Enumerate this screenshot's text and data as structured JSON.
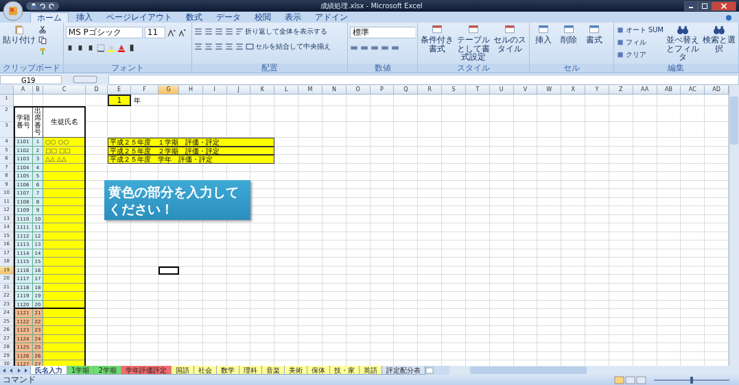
{
  "window": {
    "title": "成績処理.xlsx - Microsoft Excel"
  },
  "ribbon": {
    "tabs": [
      {
        "label": "ホーム",
        "selected": true
      },
      {
        "label": "挿入",
        "selected": false
      },
      {
        "label": "ページレイアウト",
        "selected": false
      },
      {
        "label": "数式",
        "selected": false
      },
      {
        "label": "データ",
        "selected": false
      },
      {
        "label": "校閲",
        "selected": false
      },
      {
        "label": "表示",
        "selected": false
      },
      {
        "label": "アドイン",
        "selected": false
      }
    ],
    "groups": [
      {
        "kind": "clipboard",
        "label": "クリップボード",
        "paste": "貼り付け"
      },
      {
        "kind": "font",
        "label": "フォント",
        "font": "MS Pゴシック",
        "size": "11"
      },
      {
        "kind": "alignment",
        "label": "配置",
        "wrap": "折り返して全体を表示する",
        "merge": "セルを結合して中央揃え"
      },
      {
        "kind": "number",
        "label": "数値",
        "format": "標準"
      },
      {
        "kind": "styles",
        "label": "スタイル",
        "buttons": [
          "条件付き書式",
          "テーブルとして書式設定",
          "セルのスタイル"
        ]
      },
      {
        "kind": "cells",
        "label": "セル",
        "buttons": [
          "挿入",
          "削除",
          "書式"
        ]
      },
      {
        "kind": "editing",
        "label": "編集",
        "small": [
          "オート SUM",
          "フィル",
          "クリア"
        ],
        "buttons": [
          "並べ替えとフィルタ",
          "検索と選択"
        ]
      }
    ]
  },
  "formula_bar": {
    "name_box": "G19"
  },
  "sheet": {
    "columns": [
      {
        "label": "A",
        "selected": false
      },
      {
        "label": "B",
        "selected": false
      },
      {
        "label": "C",
        "selected": false
      },
      {
        "label": "D",
        "selected": false
      },
      {
        "label": "E",
        "selected": false
      },
      {
        "label": "F",
        "selected": false
      },
      {
        "label": "G",
        "selected": true
      },
      {
        "label": "H",
        "selected": false
      },
      {
        "label": "I",
        "selected": false
      },
      {
        "label": "J",
        "selected": false
      },
      {
        "label": "K",
        "selected": false
      },
      {
        "label": "L",
        "selected": false
      },
      {
        "label": "M",
        "selected": false
      },
      {
        "label": "N",
        "selected": false
      },
      {
        "label": "O",
        "selected": false
      },
      {
        "label": "P",
        "selected": false
      },
      {
        "label": "Q",
        "selected": false
      },
      {
        "label": "R",
        "selected": false
      },
      {
        "label": "S",
        "selected": false
      },
      {
        "label": "T",
        "selected": false
      },
      {
        "label": "U",
        "selected": false
      },
      {
        "label": "V",
        "selected": false
      },
      {
        "label": "W",
        "selected": false
      },
      {
        "label": "X",
        "selected": false
      },
      {
        "label": "Y",
        "selected": false
      },
      {
        "label": "Z",
        "selected": false
      },
      {
        "label": "AA",
        "selected": false
      },
      {
        "label": "AB",
        "selected": false
      },
      {
        "label": "AC",
        "selected": false
      },
      {
        "label": "AD",
        "selected": false
      }
    ],
    "rows": [
      {
        "label": "1",
        "selected": false
      },
      {
        "label": "2",
        "selected": false
      },
      {
        "label": "3",
        "selected": false
      },
      {
        "label": "4",
        "selected": false
      },
      {
        "label": "5",
        "selected": false
      },
      {
        "label": "6",
        "selected": false
      },
      {
        "label": "7",
        "selected": false
      },
      {
        "label": "8",
        "selected": false
      },
      {
        "label": "9",
        "selected": false
      },
      {
        "label": "10",
        "selected": false
      },
      {
        "label": "11",
        "selected": false
      },
      {
        "label": "12",
        "selected": false
      },
      {
        "label": "13",
        "selected": false
      },
      {
        "label": "14",
        "selected": false
      },
      {
        "label": "15",
        "selected": false
      },
      {
        "label": "16",
        "selected": false
      },
      {
        "label": "17",
        "selected": false
      },
      {
        "label": "18",
        "selected": false
      },
      {
        "label": "19",
        "selected": true
      },
      {
        "label": "20",
        "selected": false
      },
      {
        "label": "21",
        "selected": false
      },
      {
        "label": "22",
        "selected": false
      },
      {
        "label": "23",
        "selected": false
      },
      {
        "label": "24",
        "selected": false
      },
      {
        "label": "25",
        "selected": false
      },
      {
        "label": "26",
        "selected": false
      },
      {
        "label": "27",
        "selected": false
      },
      {
        "label": "28",
        "selected": false
      },
      {
        "label": "29",
        "selected": false
      },
      {
        "label": "30",
        "selected": false
      }
    ],
    "year": {
      "value": "1",
      "unit": "年"
    },
    "headers": [
      "学籍番号",
      "出席番号",
      "生徒氏名"
    ],
    "students": [
      {
        "id": "1101",
        "no": "1",
        "name": "○○ ○○",
        "color": "#d6eef6"
      },
      {
        "id": "1102",
        "no": "2",
        "name": "□□ □□",
        "color": "#d6eef6"
      },
      {
        "id": "1103",
        "no": "3",
        "name": "△△ △△",
        "color": "#d6eef6"
      },
      {
        "id": "1104",
        "no": "4",
        "color": "#d6eef6"
      },
      {
        "id": "1105",
        "no": "5",
        "color": "#d6eef6"
      },
      {
        "id": "1106",
        "no": "6",
        "color": "#d6eef6"
      },
      {
        "id": "1107",
        "no": "7",
        "color": "#d6eef6"
      },
      {
        "id": "1108",
        "no": "8",
        "color": "#d6eef6"
      },
      {
        "id": "1109",
        "no": "9",
        "color": "#d6eef6"
      },
      {
        "id": "1110",
        "no": "10",
        "color": "#d6eef6"
      },
      {
        "id": "1111",
        "no": "11",
        "color": "#d6eef6"
      },
      {
        "id": "1112",
        "no": "12",
        "color": "#d6eef6"
      },
      {
        "id": "1113",
        "no": "13",
        "color": "#d6eef6"
      },
      {
        "id": "1114",
        "no": "14",
        "color": "#d6eef6"
      },
      {
        "id": "1115",
        "no": "15",
        "color": "#d6eef6"
      },
      {
        "id": "1116",
        "no": "16",
        "color": "#d6eef6"
      },
      {
        "id": "1117",
        "no": "17",
        "color": "#d6eef6"
      },
      {
        "id": "1118",
        "no": "18",
        "color": "#d6eef6"
      },
      {
        "id": "1119",
        "no": "19",
        "color": "#d6eef6"
      },
      {
        "id": "1120",
        "no": "20",
        "color": "#d6eef6"
      },
      {
        "id": "1121",
        "no": "21",
        "color": "#f3b98f"
      },
      {
        "id": "1122",
        "no": "22",
        "color": "#f3b98f"
      },
      {
        "id": "1123",
        "no": "23",
        "color": "#f3b98f"
      },
      {
        "id": "1124",
        "no": "24",
        "color": "#f3b98f"
      },
      {
        "id": "1125",
        "no": "25",
        "color": "#f3b98f"
      },
      {
        "id": "1126",
        "no": "26",
        "color": "#f3b98f"
      },
      {
        "id": "1127",
        "no": "27",
        "color": "#f3b98f"
      }
    ],
    "terms": [
      "平成２５年度　１学期　評価・評定",
      "平成２５年度　２学期　評価・評定",
      "平成２５年度　学年　評価・評定"
    ],
    "callout": "黄色の部分を入力してください！"
  },
  "sheet_tabs": [
    {
      "label": "氏名入力",
      "selected": true,
      "color": "#ffffff"
    },
    {
      "label": "1学期",
      "selected": false,
      "color": "#6fdc6f"
    },
    {
      "label": "2学期",
      "selected": false,
      "color": "#6fdc6f"
    },
    {
      "label": "学年評価評定",
      "selected": false,
      "color": "#f26d6d"
    },
    {
      "label": "国語",
      "selected": false,
      "color": "#ffff99"
    },
    {
      "label": "社会",
      "selected": false,
      "color": "#ffff99"
    },
    {
      "label": "数学",
      "selected": false,
      "color": "#ffff99"
    },
    {
      "label": "理科",
      "selected": false,
      "color": "#ffff99"
    },
    {
      "label": "音楽",
      "selected": false,
      "color": "#ffff99"
    },
    {
      "label": "美術",
      "selected": false,
      "color": "#ffff99"
    },
    {
      "label": "保体",
      "selected": false,
      "color": "#ffff99"
    },
    {
      "label": "技・家",
      "selected": false,
      "color": "#ffff99"
    },
    {
      "label": "英語",
      "selected": false,
      "color": "#ffff99"
    },
    {
      "label": "評定配分表",
      "selected": false,
      "color": "#d5e3f5"
    }
  ],
  "status_bar": {
    "text": "コマンド",
    "zoom": {
      "level": 0.5
    }
  }
}
